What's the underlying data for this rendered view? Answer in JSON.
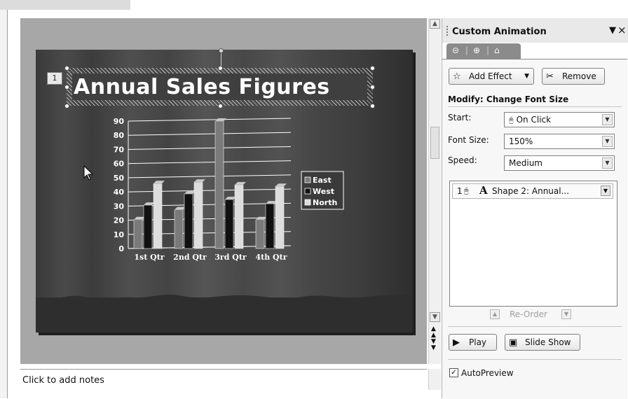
{
  "slide": {
    "animation_tag": "1",
    "title": "Annual Sales Figures"
  },
  "chart_data": {
    "type": "bar",
    "categories": [
      "1st Qtr",
      "2nd Qtr",
      "3rd Qtr",
      "4th Qtr"
    ],
    "series": [
      {
        "name": "East",
        "values": [
          20.4,
          27.4,
          90,
          20.4
        ],
        "color": "#7a7a7a"
      },
      {
        "name": "West",
        "values": [
          30.6,
          38.6,
          34.6,
          31.6
        ],
        "color": "#111111"
      },
      {
        "name": "North",
        "values": [
          45.9,
          46.9,
          45,
          43.9
        ],
        "color": "#dddddd"
      }
    ],
    "ylim": [
      0,
      90
    ],
    "yticks": [
      "0",
      "10",
      "20",
      "30",
      "40",
      "50",
      "60",
      "70",
      "80",
      "90"
    ],
    "grid": true,
    "legend_position": "right"
  },
  "notes": {
    "placeholder": "Click to add notes"
  },
  "pane": {
    "title": "Custom Animation",
    "add_effect": "Add Effect",
    "remove": "Remove",
    "modify": "Modify: Change Font Size",
    "start_label": "Start:",
    "start_value": "On Click",
    "fontsize_label": "Font Size:",
    "fontsize_value": "150%",
    "speed_label": "Speed:",
    "speed_value": "Medium",
    "list_item": {
      "number": "1",
      "text": "Shape 2: Annual..."
    },
    "reorder": "Re-Order",
    "play": "Play",
    "slideshow": "Slide Show",
    "autopreview": "AutoPreview"
  }
}
